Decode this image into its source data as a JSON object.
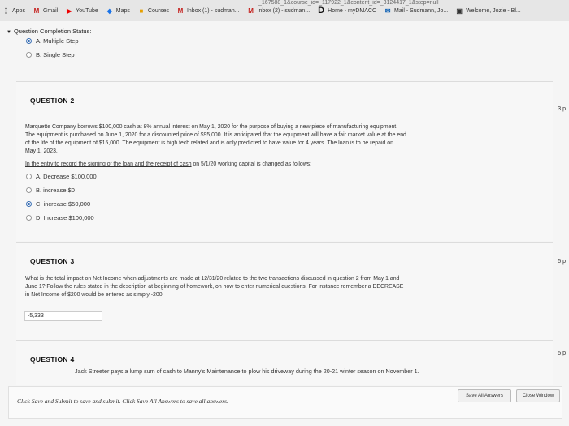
{
  "url_fragment": "_167588_1&course_id=_117922_1&content_id=_3124417_1&step=null",
  "bookmarks": [
    {
      "icon": "apps-icon",
      "label": "Apps"
    },
    {
      "icon": "gmail-icon",
      "label": "Gmail"
    },
    {
      "icon": "youtube-icon",
      "label": "YouTube"
    },
    {
      "icon": "maps-icon",
      "label": "Maps"
    },
    {
      "icon": "courses-icon",
      "label": "Courses"
    },
    {
      "icon": "gmail-icon",
      "label": "Inbox (1) - sudman..."
    },
    {
      "icon": "gmail-icon",
      "label": "Inbox (2) - sudman..."
    },
    {
      "icon": "d-icon",
      "label": "Home - myDMACC"
    },
    {
      "icon": "mail-icon",
      "label": "Mail - Sudmann, Jo..."
    },
    {
      "icon": "welcome-icon",
      "label": "Welcome, Jozie - Bl..."
    }
  ],
  "completion": {
    "label": "Question Completion Status:"
  },
  "q1": {
    "options": [
      {
        "label": "A. Multiple Step",
        "selected": true
      },
      {
        "label": "B. Single Step",
        "selected": false
      }
    ]
  },
  "q2": {
    "title": "QUESTION 2",
    "points": "3 p",
    "text_lines": [
      "Marquette Company borrows $100,000 cash at 8% annual interest on May 1, 2020 for the purpose of buying a new piece of manufacturing equipment.",
      "The equipment is purchased on June 1, 2020 for a discounted price of $95,000.  It is anticipated that the equipment will have a fair market value at the end",
      "of the life of the equipment of $15,000.  The equipment is high tech related and is only predicted to have value for 4 years.  The loan is to be repaid on",
      "May 1, 2023."
    ],
    "prompt_underlined": "In the entry to record the signing of the loan and the receipt of cash",
    "prompt_rest": " on 5/1/20 working capital is changed as follows:",
    "options": [
      {
        "label": "A. Decrease $100,000",
        "selected": false
      },
      {
        "label": "B. increase $0",
        "selected": false
      },
      {
        "label": "C. increase $50,000",
        "selected": true
      },
      {
        "label": "D. Increase $100,000",
        "selected": false
      }
    ]
  },
  "q3": {
    "title": "QUESTION 3",
    "points": "5 p",
    "text_lines": [
      "What is the total impact on Net Income when adjustments are made at 12/31/20 related to the two transactions discussed in question 2 from May 1 and",
      "June 1?  Follow the rules stated in the description at beginning of homework, on how to enter numerical questions.  For instance remember a DECREASE",
      "in Net Income of $200 would be entered as simply  -200"
    ],
    "answer": "-5,333"
  },
  "q4": {
    "title": "QUESTION 4",
    "points": "5 p",
    "text": "Jack Streeter pays a lump sum of cash to Manny's Maintenance to plow his driveway during the 20-21 winter season on November 1."
  },
  "footer": {
    "message": "Click Save and Submit to save and submit. Click Save All Answers to save all answers.",
    "save_all": "Save All Answers",
    "close": "Close Window"
  }
}
